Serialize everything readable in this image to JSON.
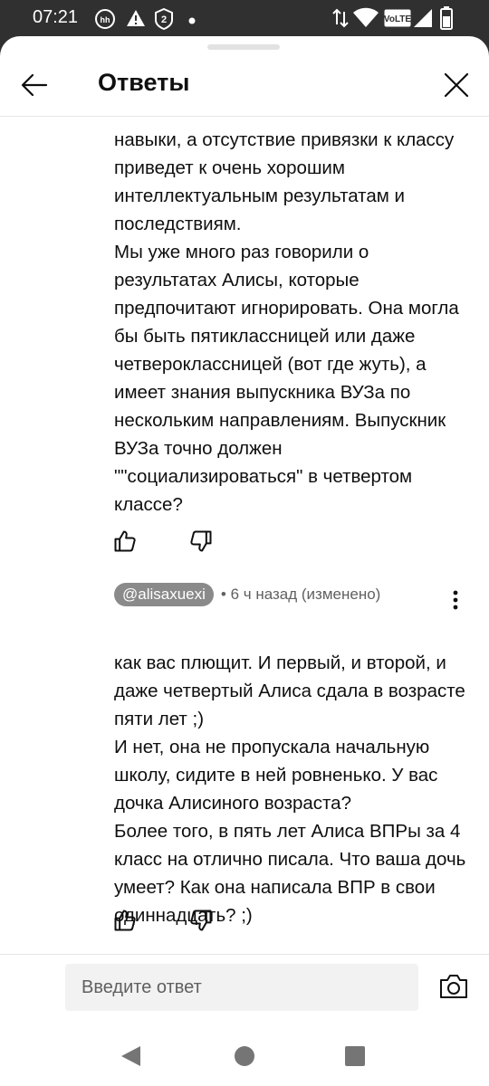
{
  "status_bar": {
    "time": "07:21",
    "volte_label": "VoLTE",
    "notification_badge": "2",
    "icons": [
      "hh-icon",
      "warning-icon",
      "badge-2-icon",
      "dot-icon",
      "data-arrows-icon",
      "wifi-icon",
      "volte-icon",
      "signal-icon",
      "battery-icon"
    ]
  },
  "header": {
    "title": "Ответы",
    "back_icon": "arrow-left-icon",
    "close_icon": "close-icon"
  },
  "comments": [
    {
      "paragraphs": [
        "навыки, а отсутствие привязки к классу приведет к очень хорошим интеллектуальным результатам и последствиям.",
        "Мы уже много раз говорили о результатах Алисы, которые предпочитают игнорировать. Она могла бы быть пятиклассницей или даже четвероклассницей (вот где жуть), а имеет знания выпускника ВУЗа по нескольким направлениям. Выпускник ВУЗа точно должен \"\"социализироваться\" в четвертом классе?"
      ]
    },
    {
      "author": "@alisaxuexi",
      "meta": "• 6 ч назад (изменено)",
      "paragraphs": [
        "как вас плющит. И первый, и второй, и даже четвертый Алиса сдала в возрасте пяти лет ;)",
        "И нет, она не пропускала начальную школу, сидите в ней ровненько. У вас дочка Алисиного возраста?",
        "Более того, в пять лет Алиса ВПРы за 4 класс на отлично писала. Что ваша дочь умеет? Как она написала ВПР в свои одиннадцать? ;)"
      ]
    }
  ],
  "reply": {
    "placeholder": "Введите ответ",
    "value": ""
  },
  "colors": {
    "status_bar_bg": "#303030",
    "sheet_bg": "#ffffff",
    "text": "#0f0f0f",
    "meta_text": "#606060",
    "author_chip_bg": "#8a8a8a",
    "input_bg": "#f2f2f2",
    "nav_icon": "#757575"
  }
}
